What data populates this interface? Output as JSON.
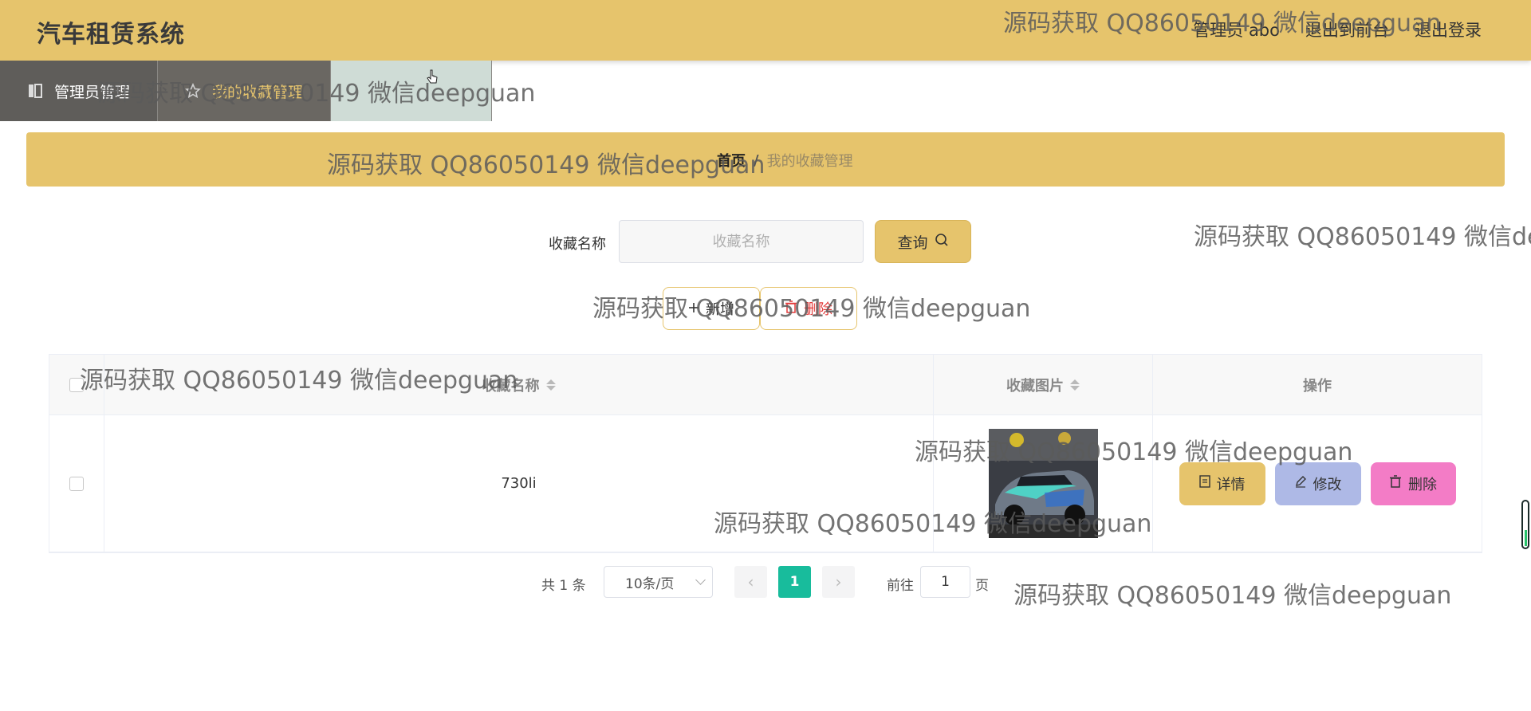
{
  "header": {
    "title": "汽车租赁系统",
    "user_label": "管理员 abo",
    "front_link": "退出到前台",
    "logout_link": "退出登录"
  },
  "nav": {
    "items": [
      {
        "label": "管理员管理",
        "icon": "book-icon"
      },
      {
        "label": "我的收藏管理",
        "icon": "star-icon"
      }
    ]
  },
  "breadcrumb": {
    "home": "首页",
    "separator": "/",
    "current": "我的收藏管理"
  },
  "search": {
    "label": "收藏名称",
    "placeholder": "收藏名称",
    "button": "查询"
  },
  "actions": {
    "add": "新增",
    "delete": "删除"
  },
  "table": {
    "columns": {
      "name": "收藏名称",
      "image": "收藏图片",
      "ops": "操作"
    },
    "rows": [
      {
        "name": "730li",
        "image": "car-photo"
      }
    ],
    "row_actions": {
      "detail": "详情",
      "edit": "修改",
      "delete": "删除"
    }
  },
  "pagination": {
    "total": "共 1 条",
    "page_size": "10条/页",
    "current_page": "1",
    "goto_label": "前往",
    "goto_value": "1",
    "page_unit": "页"
  },
  "watermark": "源码获取 QQ86050149 微信deepguan",
  "colors": {
    "accent": "#e6c46c",
    "nav_bg": "#5f5d5a",
    "page_active": "#18bc9c",
    "edit_btn": "#aeb9e6",
    "delete_btn": "#f37cc6"
  }
}
